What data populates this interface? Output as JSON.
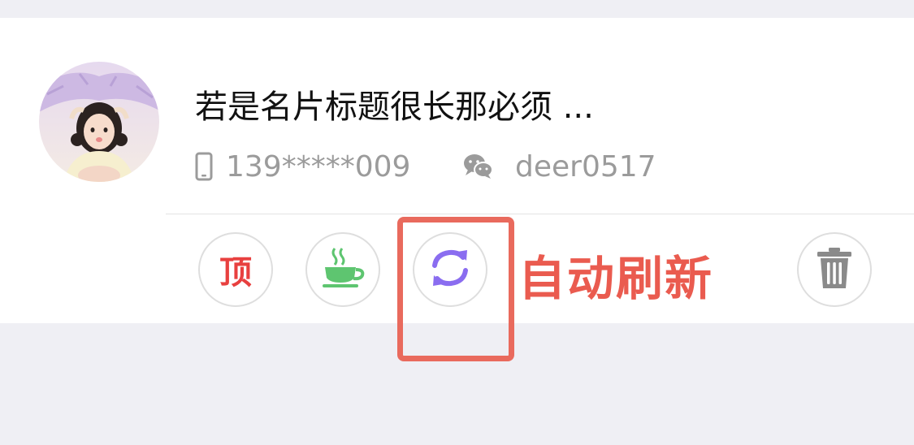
{
  "card": {
    "title": "若是名片标题很长那必须 ...",
    "phone": "139*****009",
    "wechat": "deer0517",
    "avatar_alt": "avatar",
    "actions": {
      "top_label": "顶",
      "tea_icon": "tea-cup-icon",
      "refresh_icon": "refresh-icon",
      "delete_icon": "trash-icon"
    },
    "annotation_label": "自动刷新"
  },
  "colors": {
    "top_red": "#e8403f",
    "tea_green": "#5ec570",
    "refresh_purple": "#8a6df0",
    "delete_gray": "#8a8a8a",
    "highlight_red": "#e96a5d"
  }
}
